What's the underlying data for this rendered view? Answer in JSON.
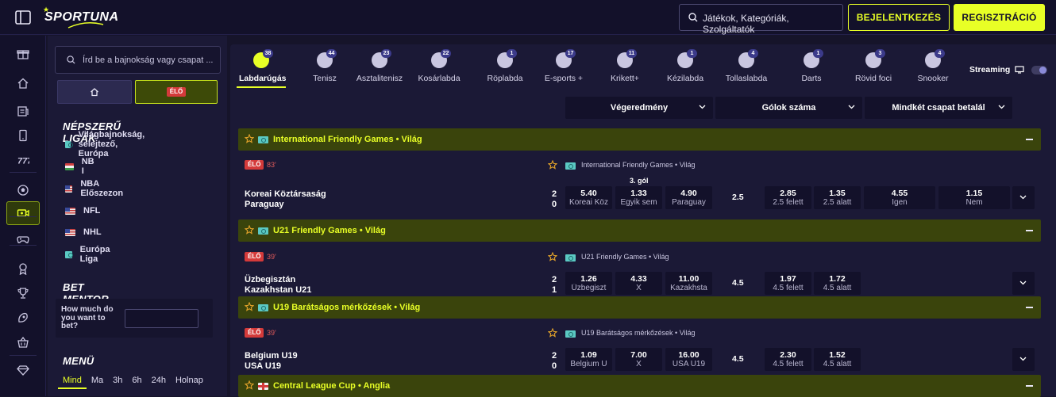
{
  "header": {
    "logo_text": "SPORTUNA",
    "search_placeholder": "Játékok, Kategóriák, Szolgáltatók",
    "login_label": "BEJELENTKEZÉS",
    "register_label": "REGISZTRÁCIÓ",
    "accent_color": "#e8ff26"
  },
  "rail": {
    "icons": [
      "gift-icon",
      "home-icon",
      "tickets-icon",
      "mobile-icon",
      "slots-icon",
      "football-icon",
      "live-video-icon",
      "gamepad-icon",
      "trophy-ribbon-icon",
      "cup-icon",
      "rocket-icon",
      "basket-icon",
      "diamond-icon"
    ],
    "active": "live-video-icon"
  },
  "left": {
    "search_placeholder": "Írd be a bajnokság vagy csapat ...",
    "live_label": "ÉLŐ",
    "popular_title": "NÉPSZERŰ LIGÁK",
    "leagues": [
      {
        "name": "Világbajnokság, selejtező, Európa",
        "flag": "world"
      },
      {
        "name": "NB I",
        "flag": "hu"
      },
      {
        "name": "NBA Előszezon",
        "flag": "us"
      },
      {
        "name": "NFL",
        "flag": "us"
      },
      {
        "name": "NHL",
        "flag": "us"
      },
      {
        "name": "Európa Liga",
        "flag": "world"
      }
    ],
    "bet_mentor": {
      "title": "BET MENTOR",
      "question": "How much do you want to bet?"
    },
    "menu": {
      "title": "MENÜ",
      "tabs": [
        "Mind",
        "Ma",
        "3h",
        "6h",
        "24h",
        "Holnap"
      ],
      "active": "Mind"
    }
  },
  "sports": [
    {
      "label": "Labdarúgás",
      "count": "38",
      "active": true
    },
    {
      "label": "Tenisz",
      "count": "44"
    },
    {
      "label": "Asztalitenisz",
      "count": "23"
    },
    {
      "label": "Kosárlabda",
      "count": "22"
    },
    {
      "label": "Röplabda",
      "count": "1"
    },
    {
      "label": "E-sports +",
      "count": "17"
    },
    {
      "label": "Krikett+",
      "count": "11"
    },
    {
      "label": "Kézilabda",
      "count": "1"
    },
    {
      "label": "Tollaslabda",
      "count": "4"
    },
    {
      "label": "Darts",
      "count": "1"
    },
    {
      "label": "Rövid foci",
      "count": "3"
    },
    {
      "label": "Snooker",
      "count": "4"
    }
  ],
  "streaming_label": "Streaming",
  "markets": [
    "Végeredmény",
    "Gólok száma",
    "Mindkét csapat betalál"
  ],
  "groups": [
    {
      "title": "International Friendly Games • Világ",
      "flag": "world",
      "event": {
        "live": "ÉLŐ",
        "minute": "83'",
        "home": "Koreai Köztársaság",
        "away": "Paraguay",
        "score_home": "2",
        "score_away": "0",
        "league": "International Friendly Games • Világ",
        "goal_label": "3. gól",
        "odds": [
          {
            "v": "5.40",
            "n": "Koreai Köz"
          },
          {
            "v": "1.33",
            "n": "Egyik sem"
          },
          {
            "v": "4.90",
            "n": "Paraguay"
          }
        ],
        "line": "2.5",
        "total": [
          {
            "v": "2.85",
            "n": "2.5 felett"
          },
          {
            "v": "1.35",
            "n": "2.5 alatt"
          }
        ],
        "btts": [
          {
            "v": "4.55",
            "n": "Igen"
          },
          {
            "v": "1.15",
            "n": "Nem"
          }
        ]
      }
    },
    {
      "title": "U21 Friendly Games • Világ",
      "flag": "world",
      "event": {
        "live": "ÉLŐ",
        "minute": "39'",
        "home": "Üzbegisztán",
        "away": "Kazakhstan U21",
        "score_home": "2",
        "score_away": "1",
        "league": "U21 Friendly Games • Világ",
        "odds": [
          {
            "v": "1.26",
            "n": "Üzbegiszt"
          },
          {
            "v": "4.33",
            "n": "X"
          },
          {
            "v": "11.00",
            "n": "Kazakhsta"
          }
        ],
        "line": "4.5",
        "total": [
          {
            "v": "1.97",
            "n": "4.5 felett"
          },
          {
            "v": "1.72",
            "n": "4.5 alatt"
          }
        ]
      }
    },
    {
      "title": "U19 Barátságos mérkőzések • Világ",
      "flag": "world",
      "event": {
        "live": "ÉLŐ",
        "minute": "39'",
        "home": "Belgium U19",
        "away": "USA U19",
        "score_home": "2",
        "score_away": "0",
        "league": "U19 Barátságos mérkőzések • Világ",
        "odds": [
          {
            "v": "1.09",
            "n": "Belgium U"
          },
          {
            "v": "7.00",
            "n": "X"
          },
          {
            "v": "16.00",
            "n": "USA U19"
          }
        ],
        "line": "4.5",
        "total": [
          {
            "v": "2.30",
            "n": "4.5 felett"
          },
          {
            "v": "1.52",
            "n": "4.5 alatt"
          }
        ]
      }
    },
    {
      "title": "Central League Cup • Anglia",
      "flag": "en"
    }
  ]
}
